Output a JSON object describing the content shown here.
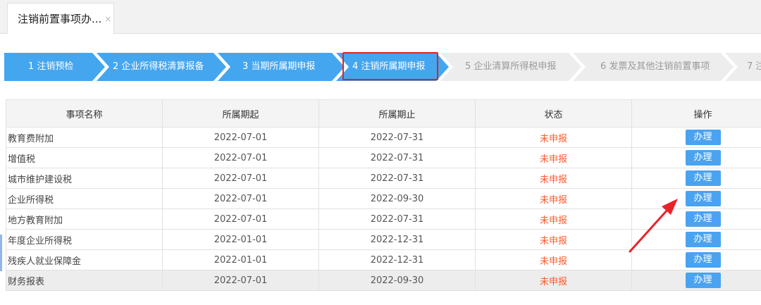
{
  "tab": {
    "title": "注销前置事项办...",
    "close": "×"
  },
  "steps": [
    {
      "label": "1  注销预检",
      "state": "done"
    },
    {
      "label": "2  企业所得税清算报备",
      "state": "done"
    },
    {
      "label": "3  当期所属期申报",
      "state": "done"
    },
    {
      "label": "4  注销所属期申报",
      "state": "current"
    },
    {
      "label": "5  企业清算所得税申报",
      "state": "todo"
    },
    {
      "label": "6  发票及其他注销前置事项",
      "state": "todo"
    },
    {
      "label": "7  注",
      "state": "todo"
    }
  ],
  "table": {
    "headers": [
      "事项名称",
      "所属期起",
      "所属期止",
      "状态",
      "操作"
    ],
    "rows": [
      {
        "name": "教育费附加",
        "start": "2022-07-01",
        "end": "2022-07-31",
        "status": "未申报",
        "action": "办理"
      },
      {
        "name": "增值税",
        "start": "2022-07-01",
        "end": "2022-07-31",
        "status": "未申报",
        "action": "办理"
      },
      {
        "name": "城市维护建设税",
        "start": "2022-07-01",
        "end": "2022-07-31",
        "status": "未申报",
        "action": "办理"
      },
      {
        "name": "企业所得税",
        "start": "2022-07-01",
        "end": "2022-09-30",
        "status": "未申报",
        "action": "办理"
      },
      {
        "name": "地方教育附加",
        "start": "2022-07-01",
        "end": "2022-07-31",
        "status": "未申报",
        "action": "办理"
      },
      {
        "name": "年度企业所得税",
        "start": "2022-01-01",
        "end": "2022-12-31",
        "status": "未申报",
        "action": "办理"
      },
      {
        "name": "残疾人就业保障金",
        "start": "2022-01-01",
        "end": "2022-12-31",
        "status": "未申报",
        "action": "办理"
      },
      {
        "name": "财务报表",
        "start": "2022-07-01",
        "end": "2022-09-30",
        "status": "未申报",
        "action": "办理"
      }
    ]
  },
  "colors": {
    "step_active": "#45a6f0",
    "step_inactive": "#ededed",
    "highlight_border": "#e02222",
    "status_text": "#ff5a2c",
    "button": "#4aa3f0",
    "annotation_arrow": "#e8232a"
  },
  "icons": {
    "tab_close": "close-icon",
    "annotation": "annotation-arrow-icon"
  }
}
